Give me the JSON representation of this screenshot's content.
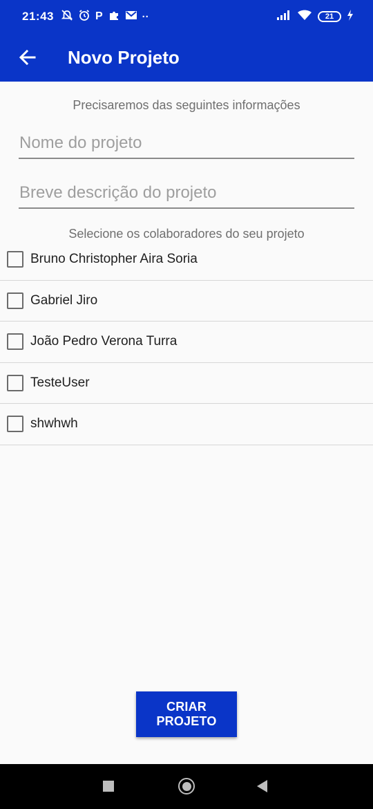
{
  "status_bar": {
    "time": "21:43",
    "notification_icons": [
      "alarm-off-icon",
      "alarm-icon",
      "p-app-icon",
      "puzzle-icon",
      "gmail-icon"
    ],
    "more": "··",
    "battery": "21",
    "colors": {
      "background": "#0a35c8"
    }
  },
  "app_bar": {
    "title": "Novo Projeto",
    "back_icon": "arrow-left-icon"
  },
  "form": {
    "intro": "Precisaremos das seguintes informações",
    "name_placeholder": "Nome do projeto",
    "description_placeholder": "Breve descrição do projeto",
    "collaborators_label": "Selecione os colaboradores do seu projeto"
  },
  "collaborators": [
    {
      "name": "Bruno Christopher Aira Soria",
      "checked": false
    },
    {
      "name": "Gabriel Jiro",
      "checked": false
    },
    {
      "name": "João Pedro Verona Turra",
      "checked": false
    },
    {
      "name": "TesteUser",
      "checked": false
    },
    {
      "name": "shwhwh",
      "checked": false
    }
  ],
  "actions": {
    "create_label": "CRIAR PROJETO"
  },
  "theme": {
    "primary": "#0a35c8"
  }
}
